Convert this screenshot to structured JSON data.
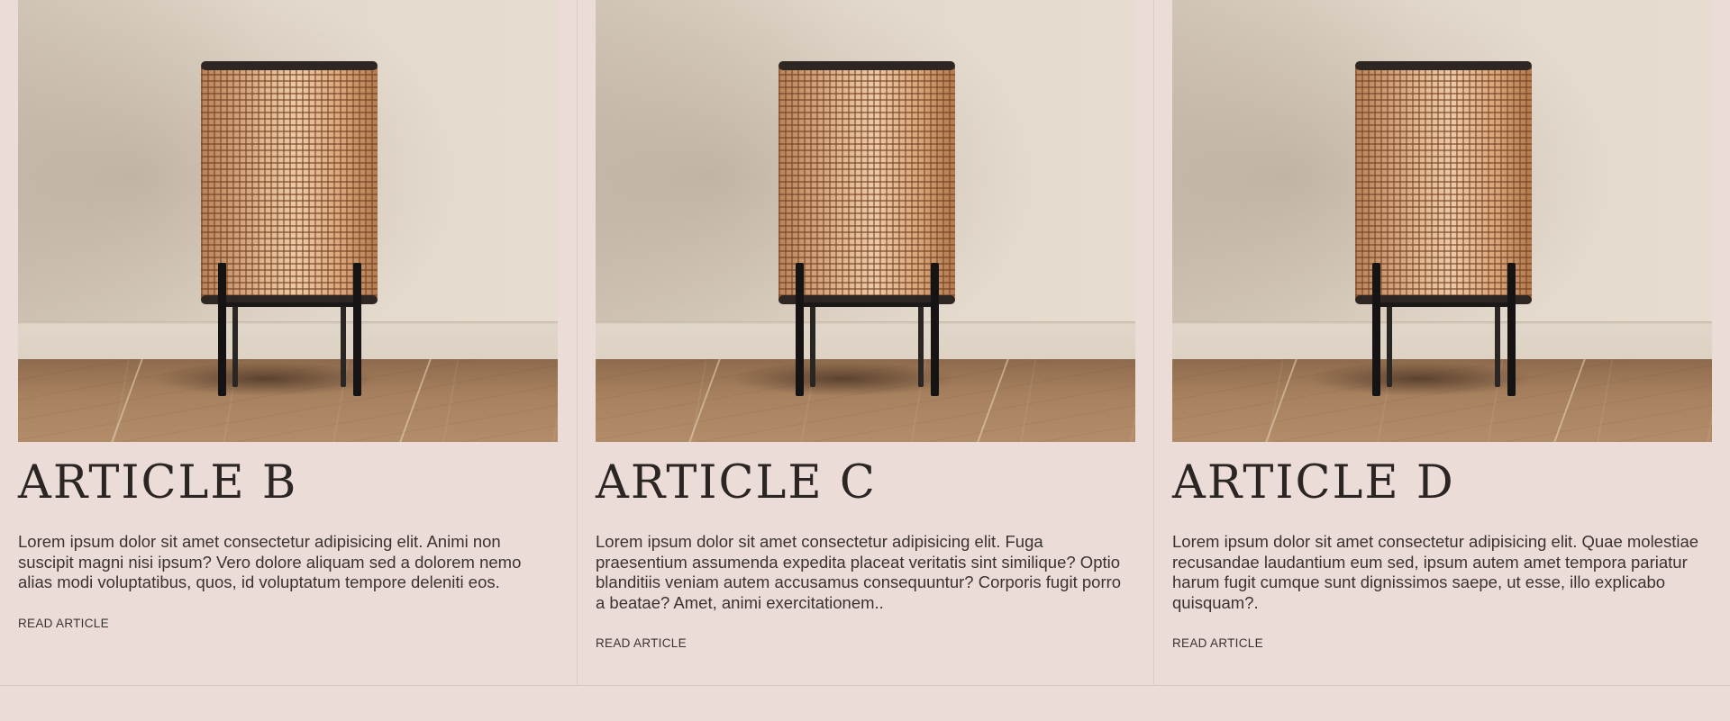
{
  "articles": [
    {
      "title": "ARTICLE B",
      "excerpt": "Lorem ipsum dolor sit amet consectetur adipisicing elit. Animi non suscipit magni nisi ipsum? Vero dolore aliquam sed a dolorem nemo alias modi voluptatibus, quos, id voluptatum tempore deleniti eos.",
      "link_label": "READ ARTICLE"
    },
    {
      "title": "ARTICLE C",
      "excerpt": "Lorem ipsum dolor sit amet consectetur adipisicing elit. Fuga praesentium assumenda expedita placeat veritatis sint similique? Optio blanditiis veniam autem accusamus consequuntur? Corporis fugit porro a beatae? Amet, animi exercitationem..",
      "link_label": "READ ARTICLE"
    },
    {
      "title": "ARTICLE D",
      "excerpt": "Lorem ipsum dolor sit amet consectetur adipisicing elit. Quae molestiae recusandae laudantium eum sed, ipsum autem amet tempora pariatur harum fugit cumque sunt dignissimos saepe, ut esse, illo explicabo quisquam?.",
      "link_label": "READ ARTICLE"
    }
  ],
  "colors": {
    "page_background": "#ebdcd8",
    "text": "#2a2422",
    "divider": "#dccbc4"
  },
  "image_subject": "rattan-table-lamp-photo"
}
